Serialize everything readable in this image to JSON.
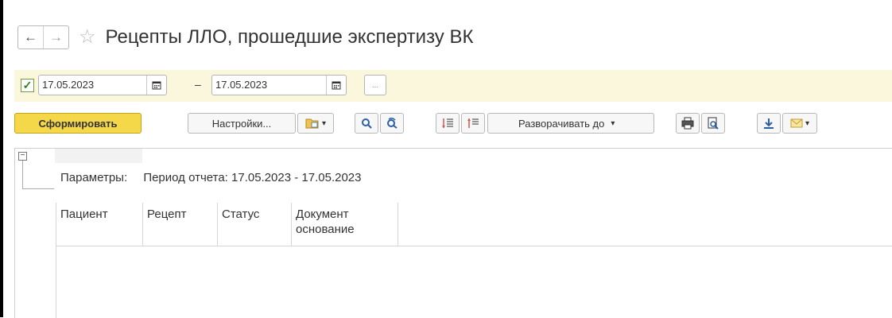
{
  "window": {
    "title": "Рецепты ЛЛО, прошедшие экспертизу ВК",
    "back_icon": "←",
    "forward_icon": "→",
    "star_icon": "☆"
  },
  "filter": {
    "checkbox_checked": true,
    "checkbox_glyph": "✓",
    "date_from": "17.05.2023",
    "date_to": "17.05.2023",
    "dash": "–",
    "more_label": "..."
  },
  "toolbar": {
    "generate_label": "Сформировать",
    "settings_label": "Настройки...",
    "expand_label": "Разворачивать до",
    "dropdown_arrow": "▾"
  },
  "report": {
    "params_label": "Параметры:",
    "period_text": "Период отчета: 17.05.2023 - 17.05.2023",
    "collapse_glyph": "−",
    "columns": [
      "Пациент",
      "Рецепт",
      "Статус",
      "Документ основание"
    ],
    "column_lines": [
      [
        "Пациент"
      ],
      [
        "Рецепт"
      ],
      [
        "Статус"
      ],
      [
        "Документ",
        "основание"
      ]
    ]
  },
  "colors": {
    "primary_button": "#f5d84a",
    "filter_bar_bg": "#fbf7dc",
    "checkbox_green": "#2e7d1f"
  }
}
